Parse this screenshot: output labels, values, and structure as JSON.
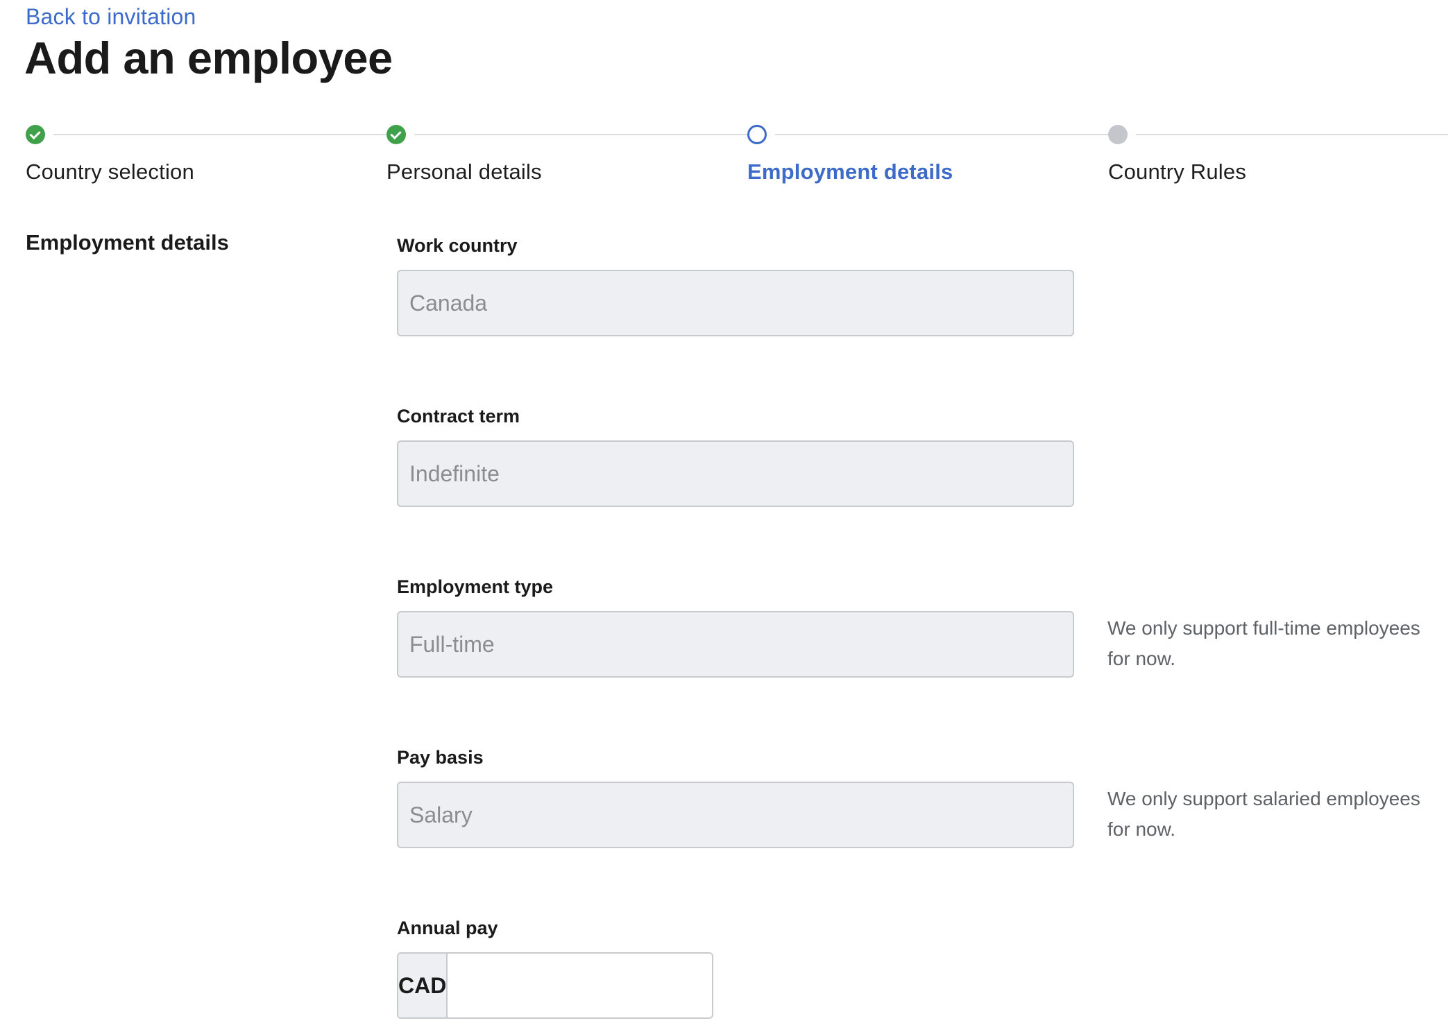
{
  "nav": {
    "back_link": "Back to invitation"
  },
  "page": {
    "title": "Add an employee"
  },
  "stepper": {
    "steps": [
      {
        "label": "Country selection",
        "status": "complete"
      },
      {
        "label": "Personal details",
        "status": "complete"
      },
      {
        "label": "Employment details",
        "status": "current"
      },
      {
        "label": "Country Rules",
        "status": "pending"
      }
    ]
  },
  "section": {
    "title": "Employment details"
  },
  "form": {
    "work_country": {
      "label": "Work country",
      "value": "Canada"
    },
    "contract_term": {
      "label": "Contract term",
      "value": "Indefinite"
    },
    "employment_type": {
      "label": "Employment type",
      "value": "Full-time",
      "help": "We only support full-time employees for now."
    },
    "pay_basis": {
      "label": "Pay basis",
      "value": "Salary",
      "help": "We only support salaried employees for now."
    },
    "annual_pay": {
      "label": "Annual pay",
      "currency": "CAD",
      "value": ""
    }
  },
  "colors": {
    "accent": "#3d6bc9",
    "success": "#3fa14a",
    "pending": "#c4c6cc",
    "input_disabled_bg": "#eeeff2"
  }
}
